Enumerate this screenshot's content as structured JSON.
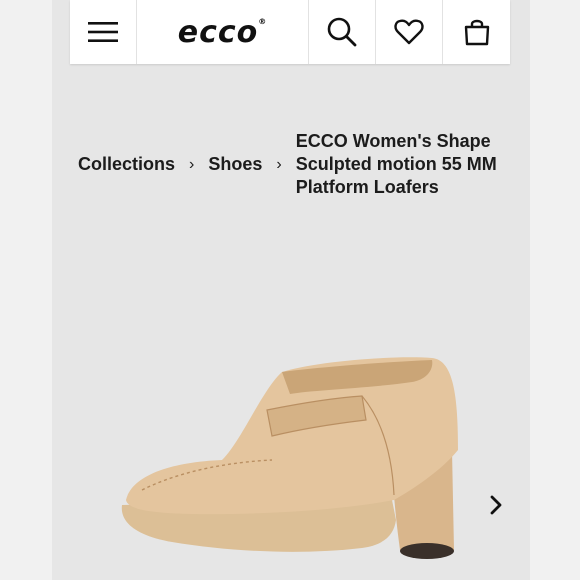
{
  "header": {
    "logo_text": "ecco",
    "logo_mark": "®",
    "icons": [
      "menu-icon",
      "search-icon",
      "heart-icon",
      "bag-icon"
    ]
  },
  "breadcrumb": {
    "items": [
      "Collections",
      "Shoes",
      "ECCO Women's Shape Sculpted motion 55 MM Platform Loafers"
    ],
    "separator": "›"
  },
  "gallery": {
    "next_icon": "chevron-right-icon"
  },
  "colors": {
    "background": "#e6e6e6",
    "header": "#ffffff",
    "text": "#1c1c1c",
    "shoe": "#e2c39c"
  }
}
